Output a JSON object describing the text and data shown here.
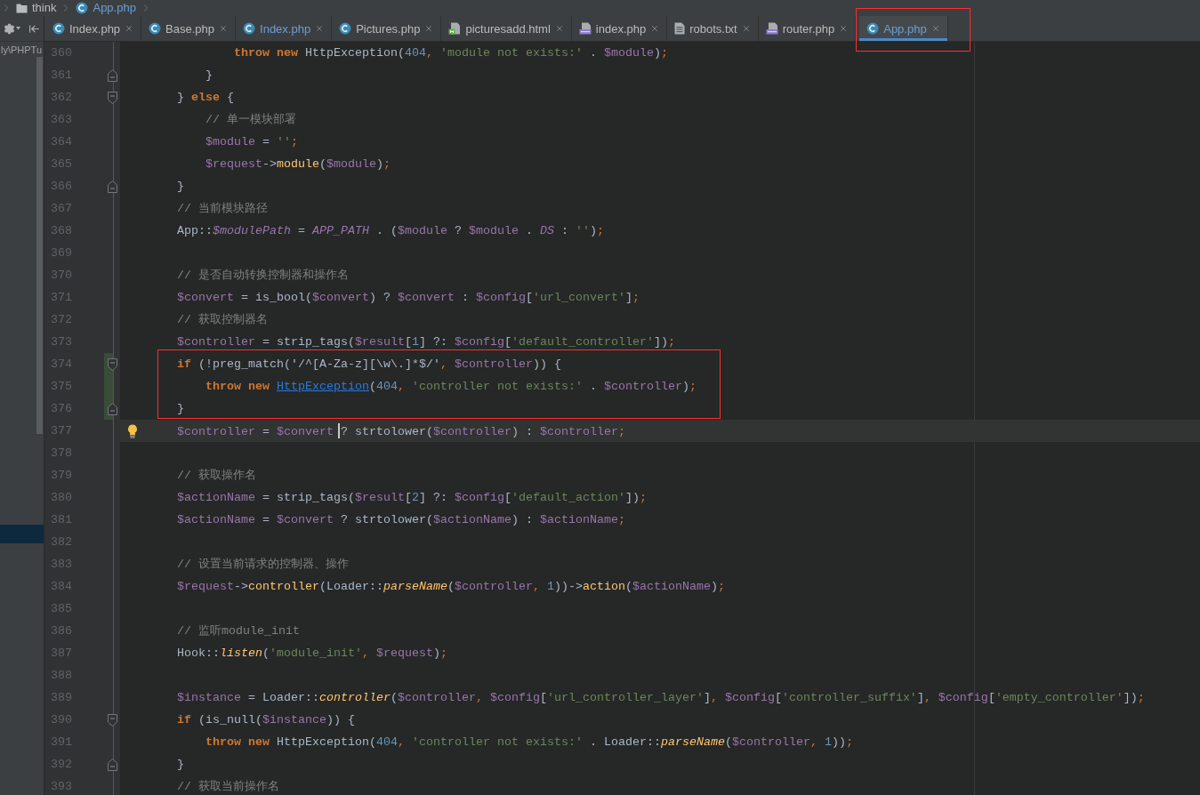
{
  "breadcrumb": [
    {
      "label": "think",
      "kind": "folder",
      "modified": false
    },
    {
      "label": "App.php",
      "kind": "class",
      "modified": true
    }
  ],
  "project_panel": {
    "path": "ly\\PHPTu"
  },
  "tabs": [
    {
      "label": "Index.php",
      "kind": "class",
      "modified": false,
      "selected": false,
      "marked": false
    },
    {
      "label": "Base.php",
      "kind": "class",
      "modified": false,
      "selected": false,
      "marked": false
    },
    {
      "label": "Index.php",
      "kind": "class",
      "modified": true,
      "selected": false,
      "marked": false
    },
    {
      "label": "Pictures.php",
      "kind": "class",
      "modified": false,
      "selected": false,
      "marked": false
    },
    {
      "label": "picturesadd.html",
      "kind": "html",
      "modified": false,
      "selected": false,
      "marked": false
    },
    {
      "label": "index.php",
      "kind": "php",
      "modified": false,
      "selected": false,
      "marked": false
    },
    {
      "label": "robots.txt",
      "kind": "text",
      "modified": false,
      "selected": false,
      "marked": false
    },
    {
      "label": "router.php",
      "kind": "php",
      "modified": false,
      "selected": false,
      "marked": false
    },
    {
      "label": "App.php",
      "kind": "class",
      "modified": true,
      "selected": true,
      "marked": true
    }
  ],
  "editor": {
    "lines": [
      {
        "number": "360",
        "current": false,
        "bulb": false,
        "changed": false,
        "marked": false,
        "tokens": [
          {
            "kind": "kw",
            "text": "        throw new"
          },
          {
            "kind": "plain",
            "text": " HttpException("
          },
          {
            "kind": "num",
            "text": "404"
          },
          {
            "kind": "punct",
            "text": ","
          },
          {
            "kind": "str",
            "text": " 'module not exists:'"
          },
          {
            "kind": "plain",
            "text": " . "
          },
          {
            "kind": "var",
            "text": "$module"
          },
          {
            "kind": "plain",
            "text": ")"
          },
          {
            "kind": "punct",
            "text": ";"
          }
        ]
      },
      {
        "number": "361",
        "fold": {
          "kind": "end"
        },
        "current": false,
        "bulb": false,
        "changed": false,
        "marked": false,
        "tokens": [
          {
            "kind": "plain",
            "text": "    }"
          }
        ]
      },
      {
        "number": "362",
        "fold": {
          "kind": "start"
        },
        "current": false,
        "bulb": false,
        "changed": false,
        "marked": false,
        "tokens": [
          {
            "kind": "plain",
            "text": "} "
          },
          {
            "kind": "kw",
            "text": "else"
          },
          {
            "kind": "plain",
            "text": " {"
          }
        ]
      },
      {
        "number": "363",
        "current": false,
        "bulb": false,
        "changed": false,
        "marked": false,
        "tokens": [
          {
            "kind": "com",
            "text": "    // 单一模块部署"
          }
        ]
      },
      {
        "number": "364",
        "current": false,
        "bulb": false,
        "changed": false,
        "marked": false,
        "tokens": [
          {
            "kind": "var",
            "text": "    $module"
          },
          {
            "kind": "plain",
            "text": " = "
          },
          {
            "kind": "str",
            "text": "''"
          },
          {
            "kind": "punct",
            "text": ";"
          }
        ]
      },
      {
        "number": "365",
        "current": false,
        "bulb": false,
        "changed": false,
        "marked": false,
        "tokens": [
          {
            "kind": "var",
            "text": "    $request"
          },
          {
            "kind": "plain",
            "text": "->"
          },
          {
            "kind": "meth",
            "text": "module"
          },
          {
            "kind": "plain",
            "text": "("
          },
          {
            "kind": "var",
            "text": "$module"
          },
          {
            "kind": "plain",
            "text": ")"
          },
          {
            "kind": "punct",
            "text": ";"
          }
        ]
      },
      {
        "number": "366",
        "fold": {
          "kind": "end"
        },
        "current": false,
        "bulb": false,
        "changed": false,
        "marked": false,
        "tokens": [
          {
            "kind": "plain",
            "text": "}"
          }
        ]
      },
      {
        "number": "367",
        "current": false,
        "bulb": false,
        "changed": false,
        "marked": false,
        "tokens": [
          {
            "kind": "com",
            "text": "// 当前模块路径"
          }
        ]
      },
      {
        "number": "368",
        "current": false,
        "bulb": false,
        "changed": false,
        "marked": false,
        "tokens": [
          {
            "kind": "plain",
            "text": "App::"
          },
          {
            "kind": "const",
            "text": "$modulePath"
          },
          {
            "kind": "plain",
            "text": " = "
          },
          {
            "kind": "const",
            "text": "APP_PATH"
          },
          {
            "kind": "plain",
            "text": " . ("
          },
          {
            "kind": "var",
            "text": "$module"
          },
          {
            "kind": "plain",
            "text": " ? "
          },
          {
            "kind": "var",
            "text": "$module"
          },
          {
            "kind": "plain",
            "text": " . "
          },
          {
            "kind": "const",
            "text": "DS"
          },
          {
            "kind": "plain",
            "text": " : "
          },
          {
            "kind": "str",
            "text": "''"
          },
          {
            "kind": "plain",
            "text": ")"
          },
          {
            "kind": "punct",
            "text": ";"
          }
        ]
      },
      {
        "number": "369",
        "current": false,
        "bulb": false,
        "changed": false,
        "marked": false
      },
      {
        "number": "370",
        "current": false,
        "bulb": false,
        "changed": false,
        "marked": false,
        "tokens": [
          {
            "kind": "com",
            "text": "// 是否自动转换控制器和操作名"
          }
        ]
      },
      {
        "number": "371",
        "current": false,
        "bulb": false,
        "changed": false,
        "marked": false,
        "tokens": [
          {
            "kind": "var",
            "text": "$convert"
          },
          {
            "kind": "plain",
            "text": " = is_bool("
          },
          {
            "kind": "var",
            "text": "$convert"
          },
          {
            "kind": "plain",
            "text": ") ? "
          },
          {
            "kind": "var",
            "text": "$convert"
          },
          {
            "kind": "plain",
            "text": " : "
          },
          {
            "kind": "var",
            "text": "$config"
          },
          {
            "kind": "plain",
            "text": "["
          },
          {
            "kind": "str",
            "text": "'url_convert'"
          },
          {
            "kind": "plain",
            "text": "]"
          },
          {
            "kind": "punct",
            "text": ";"
          }
        ]
      },
      {
        "number": "372",
        "current": false,
        "bulb": false,
        "changed": false,
        "marked": false,
        "tokens": [
          {
            "kind": "com",
            "text": "// 获取控制器名"
          }
        ]
      },
      {
        "number": "373",
        "current": false,
        "bulb": false,
        "changed": false,
        "marked": false,
        "tokens": [
          {
            "kind": "var",
            "text": "$controller"
          },
          {
            "kind": "plain",
            "text": " = strip_tags("
          },
          {
            "kind": "var",
            "text": "$result"
          },
          {
            "kind": "plain",
            "text": "["
          },
          {
            "kind": "num",
            "text": "1"
          },
          {
            "kind": "plain",
            "text": "] ?: "
          },
          {
            "kind": "var",
            "text": "$config"
          },
          {
            "kind": "plain",
            "text": "["
          },
          {
            "kind": "str",
            "text": "'default_controller'"
          },
          {
            "kind": "plain",
            "text": "])"
          },
          {
            "kind": "punct",
            "text": ";"
          }
        ]
      },
      {
        "number": "374",
        "fold": {
          "kind": "start"
        },
        "current": false,
        "bulb": false,
        "changed": true,
        "marked": true,
        "tokens": [
          {
            "kind": "kw",
            "text": "if"
          },
          {
            "kind": "plain",
            "text": " (!preg_match('/^[A-Za-z][\\w\\.]*$/'"
          },
          {
            "kind": "punct",
            "text": ","
          },
          {
            "kind": "var",
            "text": " $controller"
          },
          {
            "kind": "plain",
            "text": ")) {"
          }
        ]
      },
      {
        "number": "375",
        "current": false,
        "bulb": false,
        "changed": true,
        "marked": true,
        "tokens": [
          {
            "kind": "kw",
            "text": "    throw new "
          },
          {
            "kind": "link",
            "text": "HttpException"
          },
          {
            "kind": "plain",
            "text": "("
          },
          {
            "kind": "num",
            "text": "404"
          },
          {
            "kind": "punct",
            "text": ","
          },
          {
            "kind": "str",
            "text": " 'controller not exists:'"
          },
          {
            "kind": "plain",
            "text": " . "
          },
          {
            "kind": "var",
            "text": "$controller"
          },
          {
            "kind": "plain",
            "text": ")"
          },
          {
            "kind": "punct",
            "text": ";"
          }
        ]
      },
      {
        "number": "376",
        "fold": {
          "kind": "end"
        },
        "current": false,
        "bulb": false,
        "changed": true,
        "marked": true,
        "tokens": [
          {
            "kind": "plain",
            "text": "}"
          }
        ]
      },
      {
        "number": "377",
        "current": true,
        "bulb": true,
        "changed": false,
        "marked": false,
        "tokens": [
          {
            "kind": "var",
            "text": "$controller"
          },
          {
            "kind": "plain",
            "text": " = "
          },
          {
            "kind": "var",
            "text": "$convert "
          },
          {
            "kind": "caret"
          },
          {
            "kind": "plain",
            "text": "? strtolower("
          },
          {
            "kind": "var",
            "text": "$controller"
          },
          {
            "kind": "plain",
            "text": ") : "
          },
          {
            "kind": "var",
            "text": "$controller"
          },
          {
            "kind": "punct",
            "text": ";"
          }
        ]
      },
      {
        "number": "378",
        "current": false,
        "bulb": false,
        "changed": false,
        "marked": false
      },
      {
        "number": "379",
        "current": false,
        "bulb": false,
        "changed": false,
        "marked": false,
        "tokens": [
          {
            "kind": "com",
            "text": "// 获取操作名"
          }
        ]
      },
      {
        "number": "380",
        "current": false,
        "bulb": false,
        "changed": false,
        "marked": false,
        "tokens": [
          {
            "kind": "var",
            "text": "$actionName"
          },
          {
            "kind": "plain",
            "text": " = strip_tags("
          },
          {
            "kind": "var",
            "text": "$result"
          },
          {
            "kind": "plain",
            "text": "["
          },
          {
            "kind": "num",
            "text": "2"
          },
          {
            "kind": "plain",
            "text": "] ?: "
          },
          {
            "kind": "var",
            "text": "$config"
          },
          {
            "kind": "plain",
            "text": "["
          },
          {
            "kind": "str",
            "text": "'default_action'"
          },
          {
            "kind": "plain",
            "text": "])"
          },
          {
            "kind": "punct",
            "text": ";"
          }
        ]
      },
      {
        "number": "381",
        "current": false,
        "bulb": false,
        "changed": false,
        "marked": false,
        "tokens": [
          {
            "kind": "var",
            "text": "$actionName"
          },
          {
            "kind": "plain",
            "text": " = "
          },
          {
            "kind": "var",
            "text": "$convert"
          },
          {
            "kind": "plain",
            "text": " ? strtolower("
          },
          {
            "kind": "var",
            "text": "$actionName"
          },
          {
            "kind": "plain",
            "text": ") : "
          },
          {
            "kind": "var",
            "text": "$actionName"
          },
          {
            "kind": "punct",
            "text": ";"
          }
        ]
      },
      {
        "number": "382",
        "current": false,
        "bulb": false,
        "changed": false,
        "marked": false
      },
      {
        "number": "383",
        "current": false,
        "bulb": false,
        "changed": false,
        "marked": false,
        "tokens": [
          {
            "kind": "com",
            "text": "// 设置当前请求的控制器、操作"
          }
        ]
      },
      {
        "number": "384",
        "current": false,
        "bulb": false,
        "changed": false,
        "marked": false,
        "tokens": [
          {
            "kind": "var",
            "text": "$request"
          },
          {
            "kind": "plain",
            "text": "->"
          },
          {
            "kind": "meth",
            "text": "controller"
          },
          {
            "kind": "plain",
            "text": "(Loader::"
          },
          {
            "kind": "fn",
            "text": "parseName"
          },
          {
            "kind": "plain",
            "text": "("
          },
          {
            "kind": "var",
            "text": "$controller"
          },
          {
            "kind": "punct",
            "text": ","
          },
          {
            "kind": "num",
            "text": " 1"
          },
          {
            "kind": "plain",
            "text": "))->"
          },
          {
            "kind": "meth",
            "text": "action"
          },
          {
            "kind": "plain",
            "text": "("
          },
          {
            "kind": "var",
            "text": "$actionName"
          },
          {
            "kind": "plain",
            "text": ")"
          },
          {
            "kind": "punct",
            "text": ";"
          }
        ]
      },
      {
        "number": "385",
        "current": false,
        "bulb": false,
        "changed": false,
        "marked": false
      },
      {
        "number": "386",
        "current": false,
        "bulb": false,
        "changed": false,
        "marked": false,
        "tokens": [
          {
            "kind": "com",
            "text": "// 监听module_init"
          }
        ]
      },
      {
        "number": "387",
        "current": false,
        "bulb": false,
        "changed": false,
        "marked": false,
        "tokens": [
          {
            "kind": "plain",
            "text": "Hook::"
          },
          {
            "kind": "fn",
            "text": "listen"
          },
          {
            "kind": "plain",
            "text": "("
          },
          {
            "kind": "str",
            "text": "'module_init'"
          },
          {
            "kind": "punct",
            "text": ","
          },
          {
            "kind": "var",
            "text": " $request"
          },
          {
            "kind": "plain",
            "text": ")"
          },
          {
            "kind": "punct",
            "text": ";"
          }
        ]
      },
      {
        "number": "388",
        "current": false,
        "bulb": false,
        "changed": false,
        "marked": false
      },
      {
        "number": "389",
        "current": false,
        "bulb": false,
        "changed": false,
        "marked": false,
        "tokens": [
          {
            "kind": "var",
            "text": "$instance"
          },
          {
            "kind": "plain",
            "text": " = Loader::"
          },
          {
            "kind": "fn",
            "text": "controller"
          },
          {
            "kind": "plain",
            "text": "("
          },
          {
            "kind": "var",
            "text": "$controller"
          },
          {
            "kind": "punct",
            "text": ","
          },
          {
            "kind": "var",
            "text": " $config"
          },
          {
            "kind": "plain",
            "text": "["
          },
          {
            "kind": "str",
            "text": "'url_controller_layer'"
          },
          {
            "kind": "plain",
            "text": "]"
          },
          {
            "kind": "punct",
            "text": ","
          },
          {
            "kind": "var",
            "text": " $config"
          },
          {
            "kind": "plain",
            "text": "["
          },
          {
            "kind": "str",
            "text": "'controller_suffix'"
          },
          {
            "kind": "plain",
            "text": "]"
          },
          {
            "kind": "punct",
            "text": ","
          },
          {
            "kind": "var",
            "text": " $config"
          },
          {
            "kind": "plain",
            "text": "["
          },
          {
            "kind": "str",
            "text": "'empty_controller'"
          },
          {
            "kind": "plain",
            "text": "])"
          },
          {
            "kind": "punct",
            "text": ";"
          }
        ]
      },
      {
        "number": "390",
        "fold": {
          "kind": "start"
        },
        "current": false,
        "bulb": false,
        "changed": false,
        "marked": false,
        "tokens": [
          {
            "kind": "kw",
            "text": "if"
          },
          {
            "kind": "plain",
            "text": " (is_null("
          },
          {
            "kind": "var",
            "text": "$instance"
          },
          {
            "kind": "plain",
            "text": ")) {"
          }
        ]
      },
      {
        "number": "391",
        "current": false,
        "bulb": false,
        "changed": false,
        "marked": false,
        "tokens": [
          {
            "kind": "kw",
            "text": "    throw new"
          },
          {
            "kind": "plain",
            "text": " HttpException("
          },
          {
            "kind": "num",
            "text": "404"
          },
          {
            "kind": "punct",
            "text": ","
          },
          {
            "kind": "str",
            "text": " 'controller not exists:'"
          },
          {
            "kind": "plain",
            "text": " . Loader::"
          },
          {
            "kind": "fn",
            "text": "parseName"
          },
          {
            "kind": "plain",
            "text": "("
          },
          {
            "kind": "var",
            "text": "$controller"
          },
          {
            "kind": "punct",
            "text": ","
          },
          {
            "kind": "num",
            "text": " 1"
          },
          {
            "kind": "plain",
            "text": "))"
          },
          {
            "kind": "punct",
            "text": ";"
          }
        ]
      },
      {
        "number": "392",
        "fold": {
          "kind": "end"
        },
        "current": false,
        "bulb": false,
        "changed": false,
        "marked": false,
        "tokens": [
          {
            "kind": "plain",
            "text": "}"
          }
        ]
      },
      {
        "number": "393",
        "current": false,
        "bulb": false,
        "changed": false,
        "marked": false,
        "tokens": [
          {
            "kind": "com",
            "text": "// 获取当前操作名"
          }
        ]
      }
    ]
  }
}
